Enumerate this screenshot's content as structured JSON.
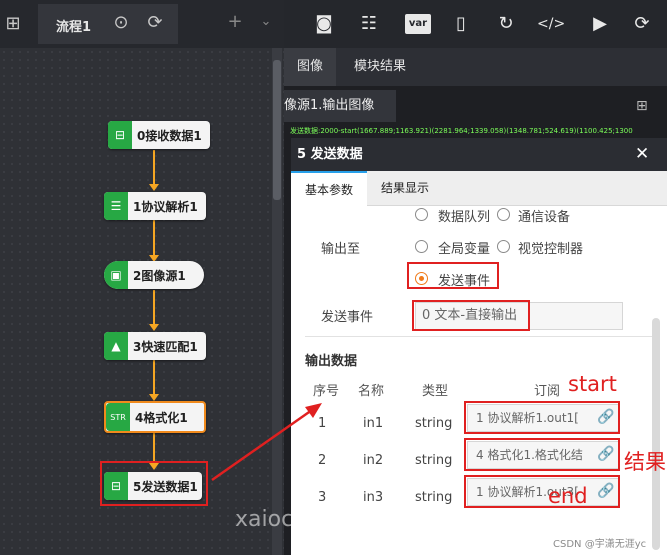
{
  "flow": {
    "tab_title": "流程1",
    "nodes": [
      {
        "label": "0接收数据1",
        "icon": "receive-data-icon"
      },
      {
        "label": "1协议解析1",
        "icon": "protocol-parse-icon"
      },
      {
        "label": "2图像源1",
        "icon": "image-source-icon"
      },
      {
        "label": "3快速匹配1",
        "icon": "fast-match-icon"
      },
      {
        "label": "4格式化1",
        "icon": "format-icon"
      },
      {
        "label": "5发送数据1",
        "icon": "send-data-icon"
      }
    ]
  },
  "toolbar": {
    "var_label": "var",
    "icons": [
      "camera-icon",
      "sliders-icon",
      "var-icon",
      "device-icon",
      "refresh-icon",
      "code-icon",
      "play-icon",
      "loop-icon"
    ]
  },
  "right_tabs": {
    "image_tab": "图像",
    "result_tab": "模块结果"
  },
  "image_selector": "像源1.输出图像",
  "status_strip": "发送数据:2000-start(1667.889;1163.921)(2281.964;1339.058)(1348.781;524.619)(1100.425;1300",
  "dialog": {
    "title": "5 发送数据",
    "tabs": [
      "基本参数",
      "结果显示"
    ],
    "output_label": "输出至",
    "radios": {
      "data_queue": "数据队列",
      "comm_device": "通信设备",
      "global_var": "全局变量",
      "vision_ctrl": "视觉控制器",
      "send_event": "发送事件"
    },
    "send_event_label": "发送事件",
    "send_event_value": "0 文本-直接输出",
    "output_data_title": "输出数据",
    "table": {
      "headers": [
        "序号",
        "名称",
        "类型",
        "订阅"
      ],
      "rows": [
        {
          "index": "1",
          "name": "in1",
          "type": "string",
          "sub": "1 协议解析1.out1["
        },
        {
          "index": "2",
          "name": "in2",
          "type": "string",
          "sub": "4 格式化1.格式化结"
        },
        {
          "index": "3",
          "name": "in3",
          "type": "string",
          "sub": "1 协议解析1.out3["
        }
      ]
    }
  },
  "annotations": {
    "start": "start",
    "result": "结果",
    "end": "end"
  },
  "watermark": "xaiochao-Machine Vision",
  "csdn": "CSDN @宇潇无涯yc",
  "colors": {
    "node_green": "#27a844",
    "connector": "#f5a623",
    "highlight_red": "#e02020",
    "radio_orange": "#f07a1a"
  }
}
